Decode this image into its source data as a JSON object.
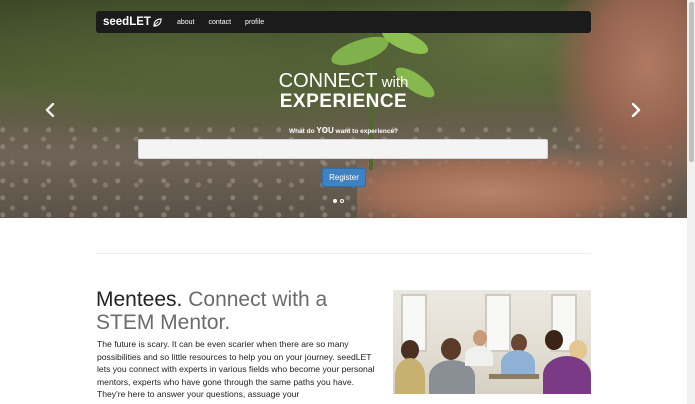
{
  "navbar": {
    "brand": "seedLET",
    "links": [
      "about",
      "contact",
      "profile"
    ]
  },
  "hero": {
    "title_line1_main": "CONNECT",
    "title_line1_small": " with",
    "title_line2": "EXPERIENCE",
    "question_prefix": "What do ",
    "question_emphasis": "YOU",
    "question_suffix": " want to experience?",
    "input_value": "",
    "register_label": "Register",
    "slide_count": 2,
    "active_slide": 1
  },
  "section": {
    "heading_strong": "Mentees.",
    "heading_rest": " Connect with a STEM Mentor.",
    "body": "The future is scary. It can be even scarier when there are so many possibilities and so little resources to help you on your journey. seedLET lets you connect with experts in various fields who become your personal mentors, experts who have gone through the same paths you have. They're here to answer your questions, assuage your"
  },
  "icons": {
    "brand": "leaf-icon",
    "prev": "chevron-left-icon",
    "next": "chevron-right-icon"
  },
  "colors": {
    "navbar": "#1b1b1b",
    "register": "#3f82c3",
    "heading": "#6b6b6b"
  }
}
